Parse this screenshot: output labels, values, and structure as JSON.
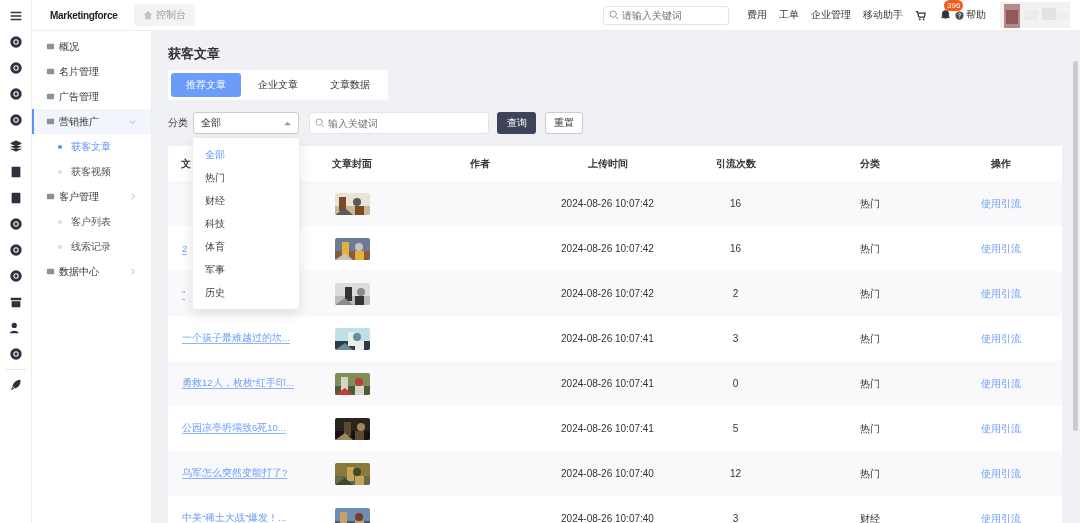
{
  "header": {
    "logo": "Marketingforce",
    "breadcrumb": "控制台",
    "search": {
      "placeholder": "请输入关键词"
    },
    "links": [
      "费用",
      "工单",
      "企业管理",
      "移动助手"
    ],
    "notifications": "396",
    "help": "帮助"
  },
  "sidebar": {
    "items": [
      {
        "label": "概况",
        "selected": false
      },
      {
        "label": "名片管理",
        "selected": false
      },
      {
        "label": "广告管理",
        "selected": false
      },
      {
        "label": "营销推广",
        "selected": true,
        "expanded": true,
        "children": [
          {
            "label": "获客文章",
            "selected": true
          },
          {
            "label": "获客视频",
            "selected": false
          }
        ]
      },
      {
        "label": "客户管理",
        "selected": false,
        "expanded": false,
        "children": [
          {
            "label": "客户列表",
            "selected": false
          },
          {
            "label": "线索记录",
            "selected": false
          }
        ]
      },
      {
        "label": "数据中心",
        "selected": false,
        "expanded": false
      }
    ]
  },
  "page_title": "获客文章",
  "tabs": [
    {
      "label": "推荐文章",
      "selected": true
    },
    {
      "label": "企业文章",
      "selected": false
    },
    {
      "label": "文章数据",
      "selected": false
    }
  ],
  "filter": {
    "label": "分类",
    "select": {
      "value": "全部",
      "options": [
        {
          "label": "全部",
          "selected": true
        },
        {
          "label": "热门",
          "selected": false
        },
        {
          "label": "财经",
          "selected": false
        },
        {
          "label": "科技",
          "selected": false
        },
        {
          "label": "体育",
          "selected": false
        },
        {
          "label": "军事",
          "selected": false
        },
        {
          "label": "历史",
          "selected": false
        }
      ]
    },
    "search": {
      "placeholder": "输入关键词"
    },
    "query_button": "查询",
    "reset_button": "重置"
  },
  "table": {
    "columns": [
      "文",
      "文章封面",
      "作者",
      "上传时间",
      "引流次数",
      "分类",
      "操作"
    ],
    "rows": [
      {
        "time": "2024-08-26 10:07:42",
        "count": "16",
        "category": "热门",
        "action": "使用引流"
      },
      {
        "title": "2",
        "time": "2024-08-26 10:07:42",
        "count": "16",
        "category": "热门",
        "action": "使用引流"
      },
      {
        "title": "“",
        "time": "2024-08-26 10:07:42",
        "count": "2",
        "category": "热门",
        "action": "使用引流"
      },
      {
        "title": "一个孩子最难越过的坎...",
        "time": "2024-08-26 10:07:41",
        "count": "3",
        "category": "热门",
        "action": "使用引流"
      },
      {
        "title": "勇救12人，枚枚“红手印...",
        "time": "2024-08-26 10:07:41",
        "count": "0",
        "category": "热门",
        "action": "使用引流"
      },
      {
        "title": "公园凉亭坍塌致6死10...",
        "time": "2024-08-26 10:07:41",
        "count": "5",
        "category": "热门",
        "action": "使用引流"
      },
      {
        "title": "乌军怎么突然变能打了?",
        "time": "2024-08-26 10:07:40",
        "count": "12",
        "category": "热门",
        "action": "使用引流"
      },
      {
        "title": "中美“稀土大战”爆发！...",
        "time": "2024-08-26 10:07:40",
        "count": "3",
        "category": "财经",
        "action": "使用引流"
      }
    ]
  }
}
